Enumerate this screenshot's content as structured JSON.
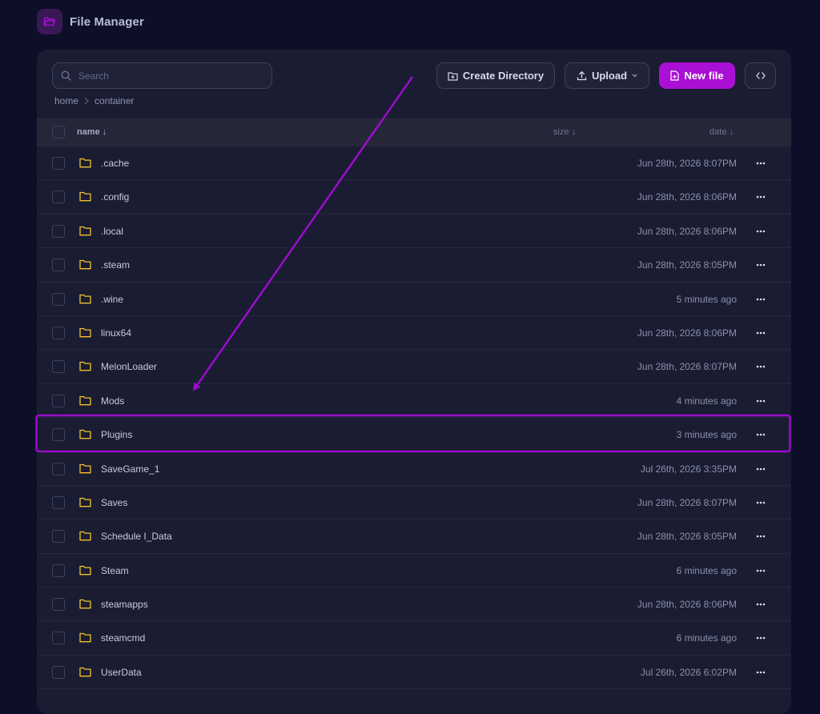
{
  "header": {
    "title": "File Manager",
    "icon": "folder-open-icon",
    "icon_color": "#a90fd4"
  },
  "search": {
    "placeholder": "Search",
    "value": ""
  },
  "breadcrumb": [
    "home",
    "container"
  ],
  "toolbar": {
    "create_directory_label": "Create Directory",
    "upload_label": "Upload",
    "new_file_label": "New file",
    "accent_color": "#a90fd4"
  },
  "table": {
    "columns": {
      "name": "name ↓",
      "size": "size ↓",
      "date": "date ↓"
    },
    "rows": [
      {
        "name": ".cache",
        "date": "Jun 28th, 2026 8:07PM"
      },
      {
        "name": ".config",
        "date": "Jun 28th, 2026 8:06PM"
      },
      {
        "name": ".local",
        "date": "Jun 28th, 2026 8:06PM"
      },
      {
        "name": ".steam",
        "date": "Jun 28th, 2026 8:05PM"
      },
      {
        "name": ".wine",
        "date": "5 minutes ago"
      },
      {
        "name": "linux64",
        "date": "Jun 28th, 2026 8:06PM"
      },
      {
        "name": "MelonLoader",
        "date": "Jun 28th, 2026 8:07PM"
      },
      {
        "name": "Mods",
        "date": "4 minutes ago"
      },
      {
        "name": "Plugins",
        "date": "3 minutes ago"
      },
      {
        "name": "SaveGame_1",
        "date": "Jul 26th, 2026 3:35PM"
      },
      {
        "name": "Saves",
        "date": "Jun 28th, 2026 8:07PM"
      },
      {
        "name": "Schedule I_Data",
        "date": "Jun 28th, 2026 8:05PM"
      },
      {
        "name": "Steam",
        "date": "6 minutes ago"
      },
      {
        "name": "steamapps",
        "date": "Jun 28th, 2026 8:06PM"
      },
      {
        "name": "steamcmd",
        "date": "6 minutes ago"
      },
      {
        "name": "UserData",
        "date": "Jul 26th, 2026 6:02PM"
      },
      {
        "name": "",
        "date": ""
      }
    ],
    "folder_icon_color": "#f2c230"
  },
  "annotation": {
    "highlighted_row": "Plugins",
    "color": "#9a0ccd"
  }
}
